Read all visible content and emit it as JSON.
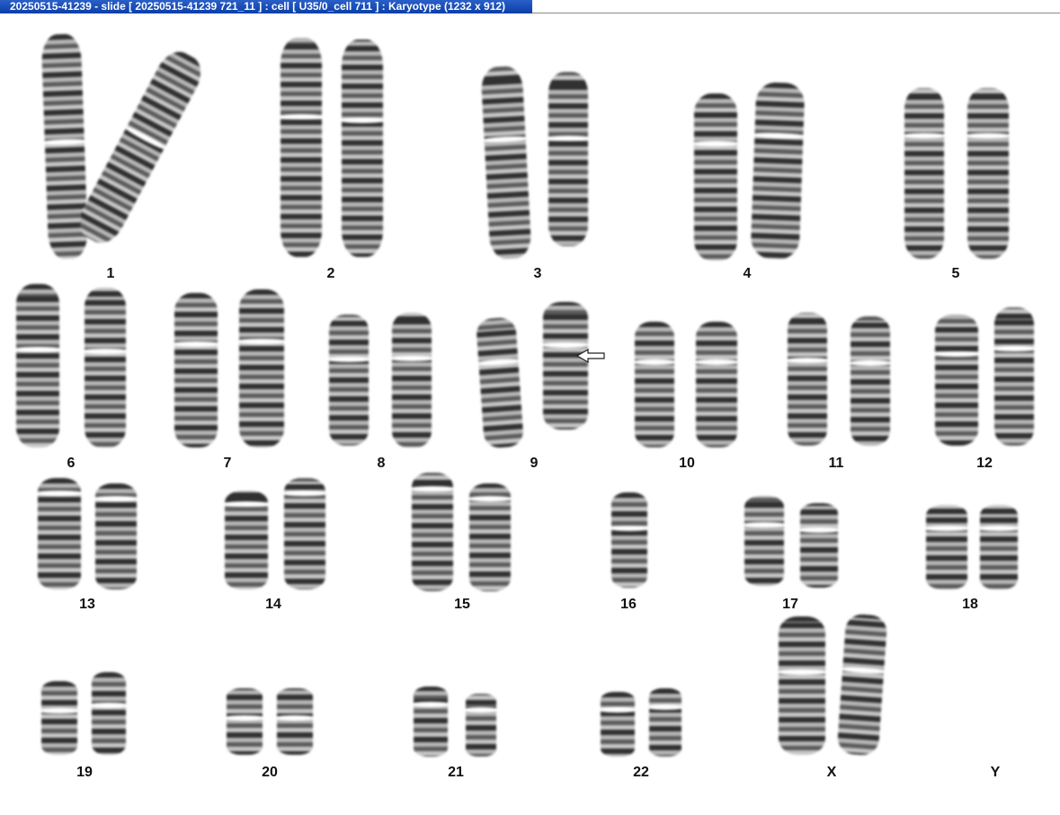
{
  "window": {
    "title": "20250515-41239 - slide [ 20250515-41239 721_11 ] : cell [ U35/0_cell 711 ] : Karyotype  (1232 x 912)"
  },
  "karyotype": {
    "labels": [
      "1",
      "2",
      "3",
      "4",
      "5",
      "6",
      "7",
      "8",
      "9",
      "10",
      "11",
      "12",
      "13",
      "14",
      "15",
      "16",
      "17",
      "18",
      "19",
      "20",
      "21",
      "22",
      "X",
      "Y"
    ],
    "marker_note": "arrow-icon"
  }
}
